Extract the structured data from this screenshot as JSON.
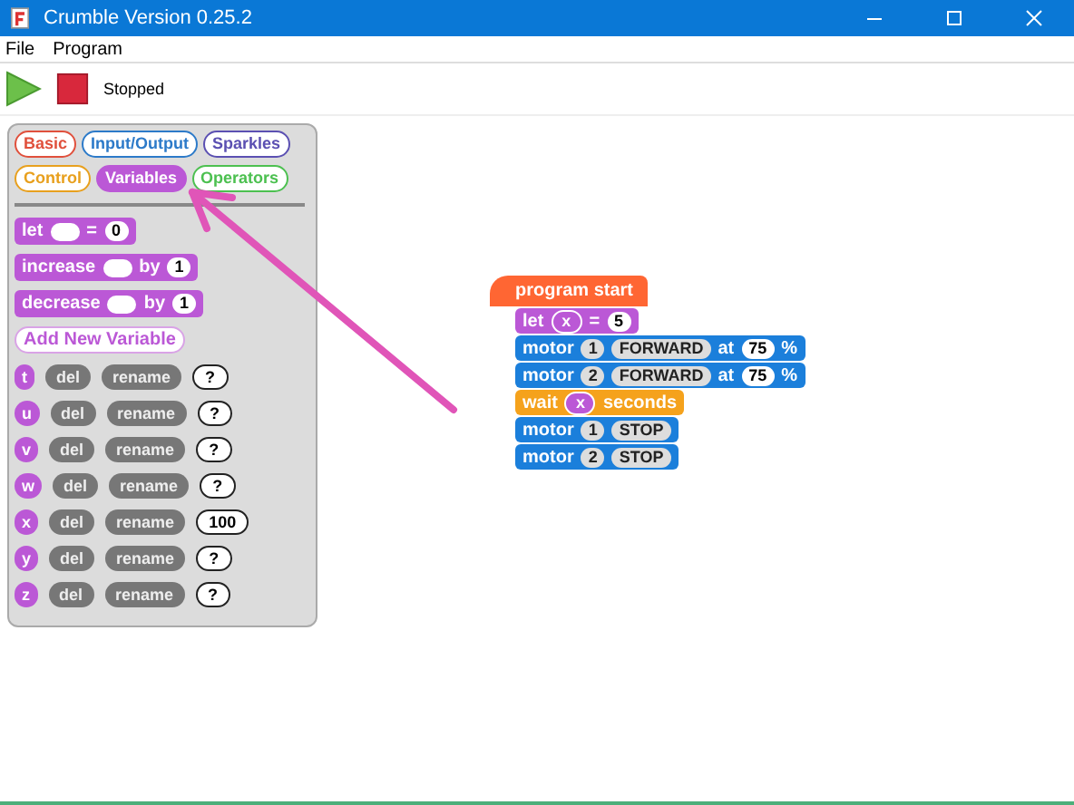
{
  "window": {
    "title": "Crumble Version 0.25.2"
  },
  "menu": [
    {
      "label": "File"
    },
    {
      "label": "Program"
    }
  ],
  "toolbar": {
    "status": "Stopped"
  },
  "categories": [
    {
      "label": "Basic",
      "color": "#e0503c",
      "selected": false
    },
    {
      "label": "Input/Output",
      "color": "#2c7ac9",
      "selected": false
    },
    {
      "label": "Sparkles",
      "color": "#5b50b2",
      "selected": false
    },
    {
      "label": "Control",
      "color": "#e8a01e",
      "selected": false
    },
    {
      "label": "Variables",
      "color": "#bb58d6",
      "selected": true
    },
    {
      "label": "Operators",
      "color": "#4cc050",
      "selected": false
    }
  ],
  "palette_blocks": [
    {
      "tokens": [
        {
          "kind": "text",
          "text": "let"
        },
        {
          "kind": "slot"
        },
        {
          "kind": "text",
          "text": "="
        },
        {
          "kind": "value",
          "text": "0"
        }
      ]
    },
    {
      "tokens": [
        {
          "kind": "text",
          "text": "increase"
        },
        {
          "kind": "slot"
        },
        {
          "kind": "text",
          "text": "by"
        },
        {
          "kind": "value",
          "text": "1"
        }
      ]
    },
    {
      "tokens": [
        {
          "kind": "text",
          "text": "decrease"
        },
        {
          "kind": "slot"
        },
        {
          "kind": "text",
          "text": "by"
        },
        {
          "kind": "value",
          "text": "1"
        }
      ]
    }
  ],
  "add_variable": "Add New Variable",
  "variables": [
    {
      "name": "t",
      "delete": "del",
      "rename": "rename",
      "value": "?"
    },
    {
      "name": "u",
      "delete": "del",
      "rename": "rename",
      "value": "?"
    },
    {
      "name": "v",
      "delete": "del",
      "rename": "rename",
      "value": "?"
    },
    {
      "name": "w",
      "delete": "del",
      "rename": "rename",
      "value": "?"
    },
    {
      "name": "x",
      "delete": "del",
      "rename": "rename",
      "value": "100"
    },
    {
      "name": "y",
      "delete": "del",
      "rename": "rename",
      "value": "?"
    },
    {
      "name": "z",
      "delete": "del",
      "rename": "rename",
      "value": "?"
    }
  ],
  "script": {
    "start": "program start",
    "blocks": [
      {
        "color": "#bb58d6",
        "tokens": [
          {
            "kind": "text",
            "text": "let"
          },
          {
            "kind": "var",
            "text": "x"
          },
          {
            "kind": "text",
            "text": "="
          },
          {
            "kind": "value",
            "text": "5"
          }
        ]
      },
      {
        "color": "#1b7fdb",
        "tokens": [
          {
            "kind": "text",
            "text": "motor"
          },
          {
            "kind": "dropdown",
            "text": "1"
          },
          {
            "kind": "dropdown",
            "text": "FORWARD"
          },
          {
            "kind": "text",
            "text": "at"
          },
          {
            "kind": "value",
            "text": "75"
          },
          {
            "kind": "text",
            "text": "%"
          }
        ]
      },
      {
        "color": "#1b7fdb",
        "tokens": [
          {
            "kind": "text",
            "text": "motor"
          },
          {
            "kind": "dropdown",
            "text": "2"
          },
          {
            "kind": "dropdown",
            "text": "FORWARD"
          },
          {
            "kind": "text",
            "text": "at"
          },
          {
            "kind": "value",
            "text": "75"
          },
          {
            "kind": "text",
            "text": "%"
          }
        ]
      },
      {
        "color": "#f5a21c",
        "tokens": [
          {
            "kind": "text",
            "text": "wait"
          },
          {
            "kind": "var",
            "text": "x"
          },
          {
            "kind": "text",
            "text": "seconds"
          }
        ]
      },
      {
        "color": "#1b7fdb",
        "tokens": [
          {
            "kind": "text",
            "text": "motor"
          },
          {
            "kind": "dropdown",
            "text": "1"
          },
          {
            "kind": "dropdown",
            "text": "STOP"
          }
        ]
      },
      {
        "color": "#1b7fdb",
        "tokens": [
          {
            "kind": "text",
            "text": "motor"
          },
          {
            "kind": "dropdown",
            "text": "2"
          },
          {
            "kind": "dropdown",
            "text": "STOP"
          }
        ]
      }
    ]
  }
}
